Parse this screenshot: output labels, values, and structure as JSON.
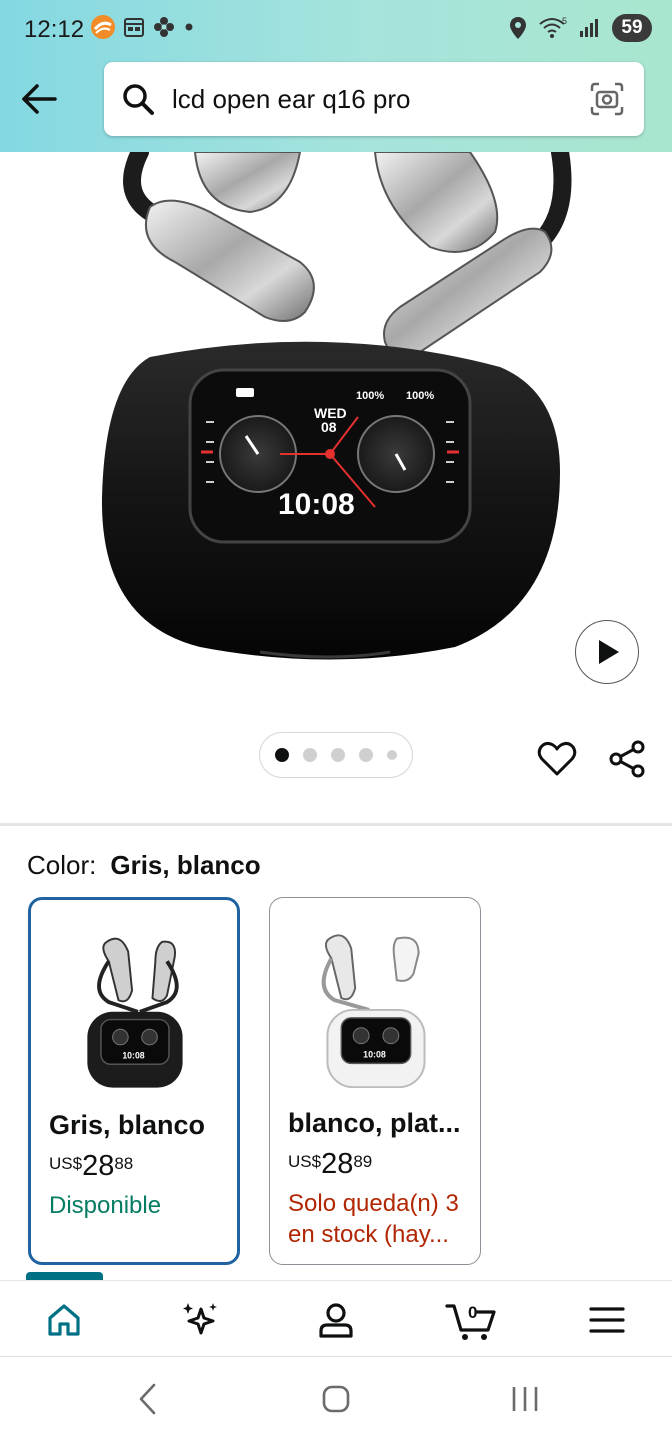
{
  "status_bar": {
    "time": "12:12",
    "icons": [
      "app-notification-icon",
      "calendar-icon",
      "pinwheel-icon",
      "dot-icon",
      "location-icon",
      "wifi-icon",
      "signal-icon"
    ],
    "battery": "59"
  },
  "search": {
    "query": "lcd open ear q16 pro"
  },
  "product": {
    "image_name": "open-ear-earbuds-with-lcd-case",
    "screen": {
      "status_left": "100%",
      "status_right": "100%",
      "day": "WED",
      "date": "08",
      "time": "10:08"
    },
    "carousel": {
      "total": 5,
      "active_index": 0
    }
  },
  "color_selection": {
    "label": "Color:",
    "selected": "Gris, blanco",
    "variants": [
      {
        "name": "Gris, blanco",
        "currency": "US$",
        "price_whole": "28",
        "price_fraction": "88",
        "availability": "Disponible",
        "availability_color": "#067d62",
        "selected": true,
        "thumb_time": "10:08"
      },
      {
        "name": "blanco, plat...",
        "currency": "US$",
        "price_whole": "28",
        "price_fraction": "89",
        "availability": "Solo queda(n) 3 en stock (hay...",
        "availability_color": "#b12704",
        "selected": false,
        "thumb_time": "10:08"
      }
    ]
  },
  "bottom_nav": {
    "items": [
      "home-icon",
      "sparkle-icon",
      "account-icon",
      "cart-icon",
      "menu-icon"
    ],
    "cart_count": "0",
    "active_item": "home",
    "accent_color": "#007185"
  },
  "system_nav": [
    "back-icon",
    "home-circle-icon",
    "recents-icon"
  ]
}
